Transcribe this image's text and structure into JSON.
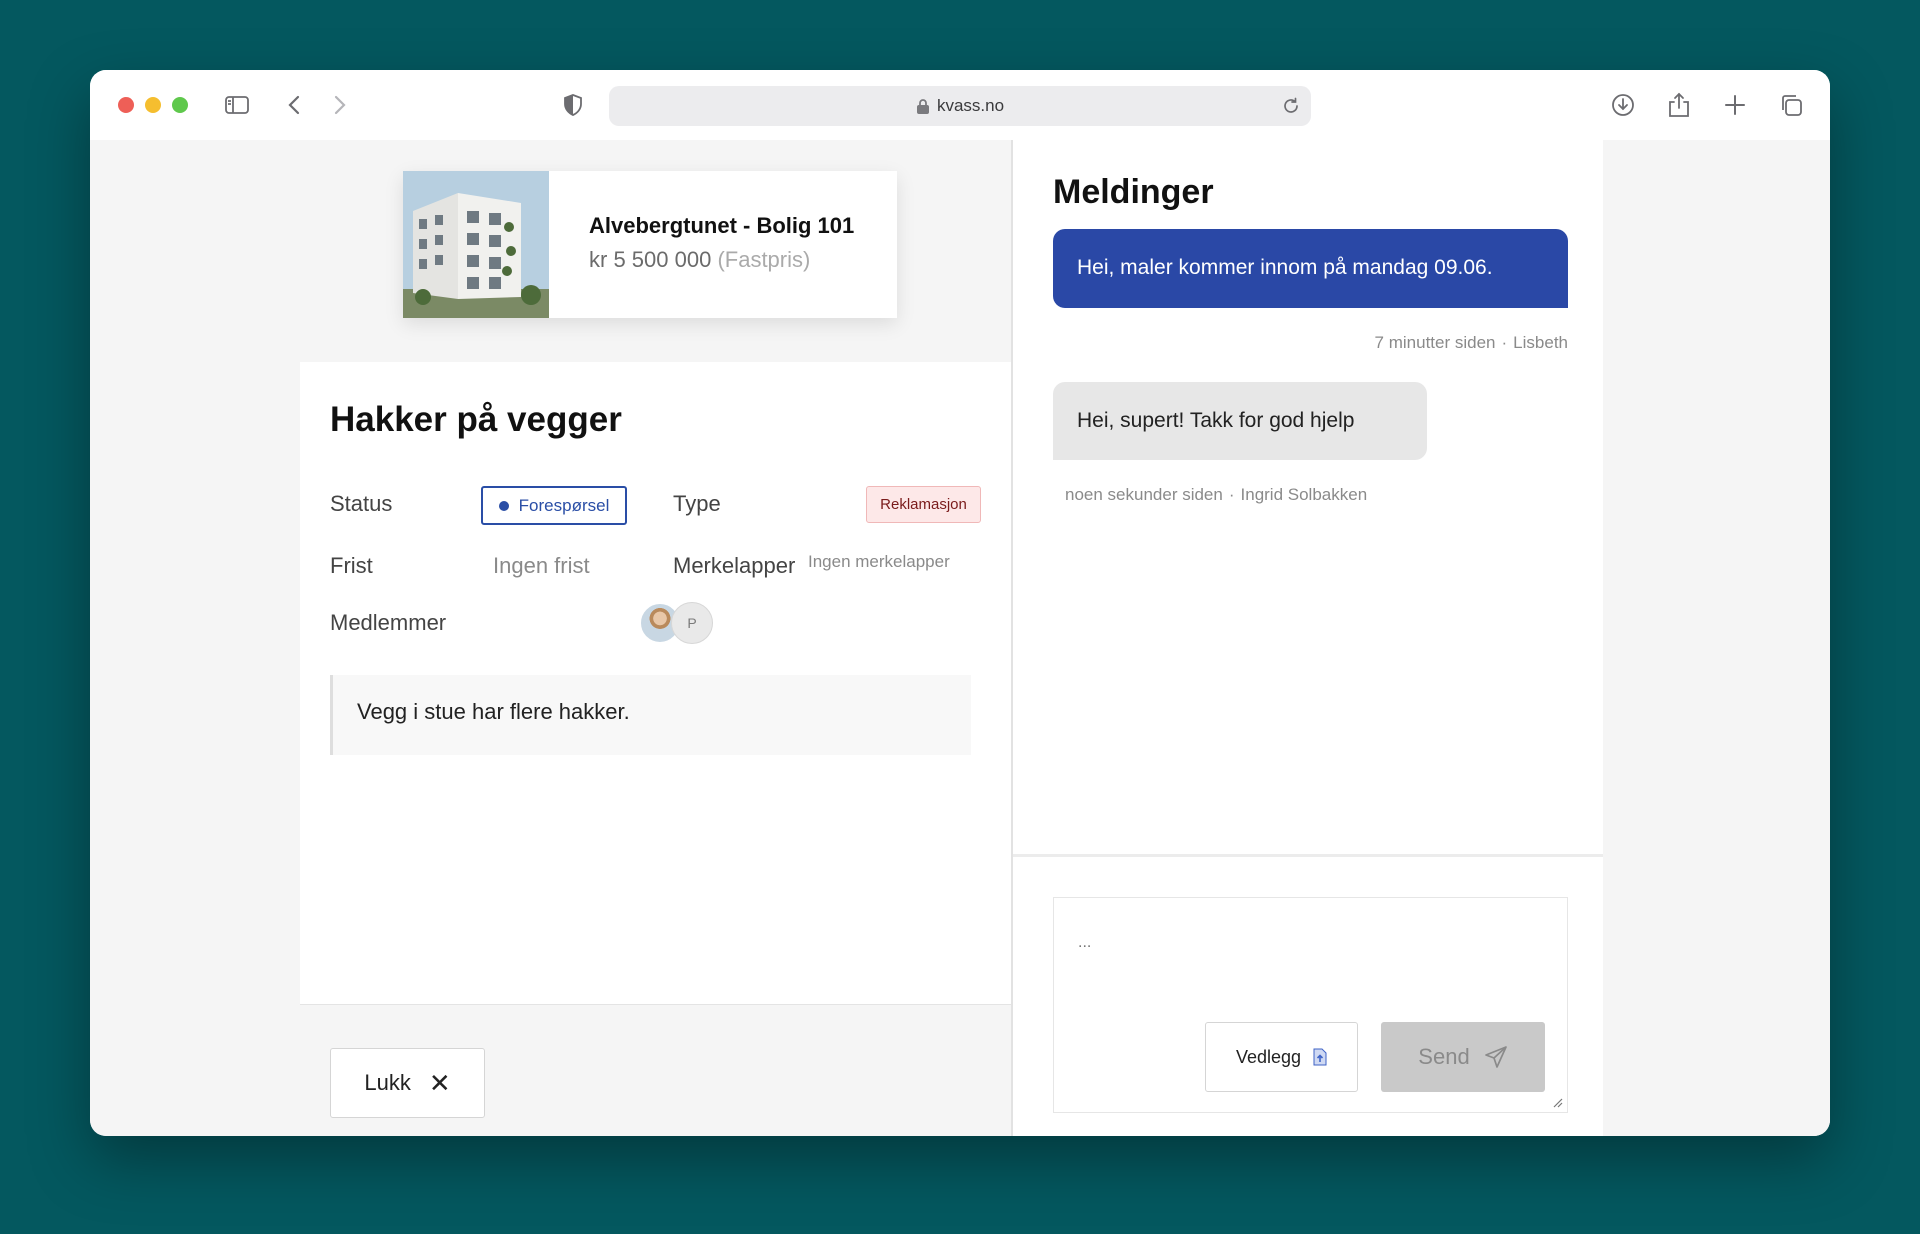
{
  "browser": {
    "url": "kvass.no"
  },
  "property": {
    "title": "Alvebergtunet - Bolig 101",
    "price": "kr 5 500 000",
    "price_note": "(Fastpris)"
  },
  "case": {
    "title": "Hakker på vegger",
    "status_label": "Status",
    "status_value": "Forespørsel",
    "type_label": "Type",
    "type_value": "Reklamasjon",
    "deadline_label": "Frist",
    "deadline_value": "Ingen frist",
    "tags_label": "Merkelapper",
    "tags_value": "Ingen merkelapper",
    "members_label": "Medlemmer",
    "member_initial": "P",
    "description": "Vegg i stue har flere hakker.",
    "close_label": "Lukk"
  },
  "messages": {
    "title": "Meldinger",
    "items": [
      {
        "text": "Hei, maler kommer innom på mandag 09.06.",
        "time": "7 minutter siden",
        "author": "Lisbeth",
        "direction": "out"
      },
      {
        "text": "Hei, supert! Takk for god hjelp",
        "time": "noen sekunder siden",
        "author": "Ingrid Solbakken",
        "direction": "in"
      }
    ],
    "separator": "·"
  },
  "compose": {
    "placeholder": "...",
    "attach_label": "Vedlegg",
    "send_label": "Send"
  },
  "colors": {
    "accent": "#2a48a6",
    "background": "#04585f",
    "type_badge_bg": "#fde8e8"
  }
}
